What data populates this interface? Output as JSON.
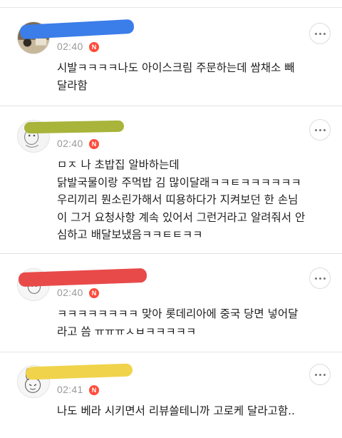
{
  "comments": [
    {
      "time": "02:40",
      "badge": "N",
      "text": "시발ㅋㅋㅋㅋ나도 아이스크림 주문하는데 쌈채소 빼\n달라함",
      "name_color": "#3b7de9"
    },
    {
      "time": "02:40",
      "badge": "N",
      "text": "ㅁㅈ 나 초밥집 알바하는데\n닭발국물이랑 주먹밥 김 많이달래ㅋㅋㅌㅋㅋㅋㅋㅋㅋ\n우리끼리 뭔소린가해서 띠용하다가 지켜보던 한 손님\n이 그거 요청사항 계속 있어서 그런거라고 알려줘서 안\n심하고 배달보냈음ㅋㅋㅌㅌㅋㅋ",
      "name_color": "#a8b43a"
    },
    {
      "time": "02:40",
      "badge": "N",
      "text": "ㅋㅋㅋㅋㅋㅋㅋㅋ 맞아 롯데리아에 중국 당면 넣어달\n라고 씀 ㅠㅠㅠㅅㅂㅋㅋㅋㅋㅋ",
      "name_color": "#e84a4a"
    },
    {
      "time": "02:41",
      "badge": "N",
      "text": "나도 베라 시키면서 리뷰쓸테니까 고로케 달라고함..",
      "name_color": "#f0d34a"
    }
  ]
}
